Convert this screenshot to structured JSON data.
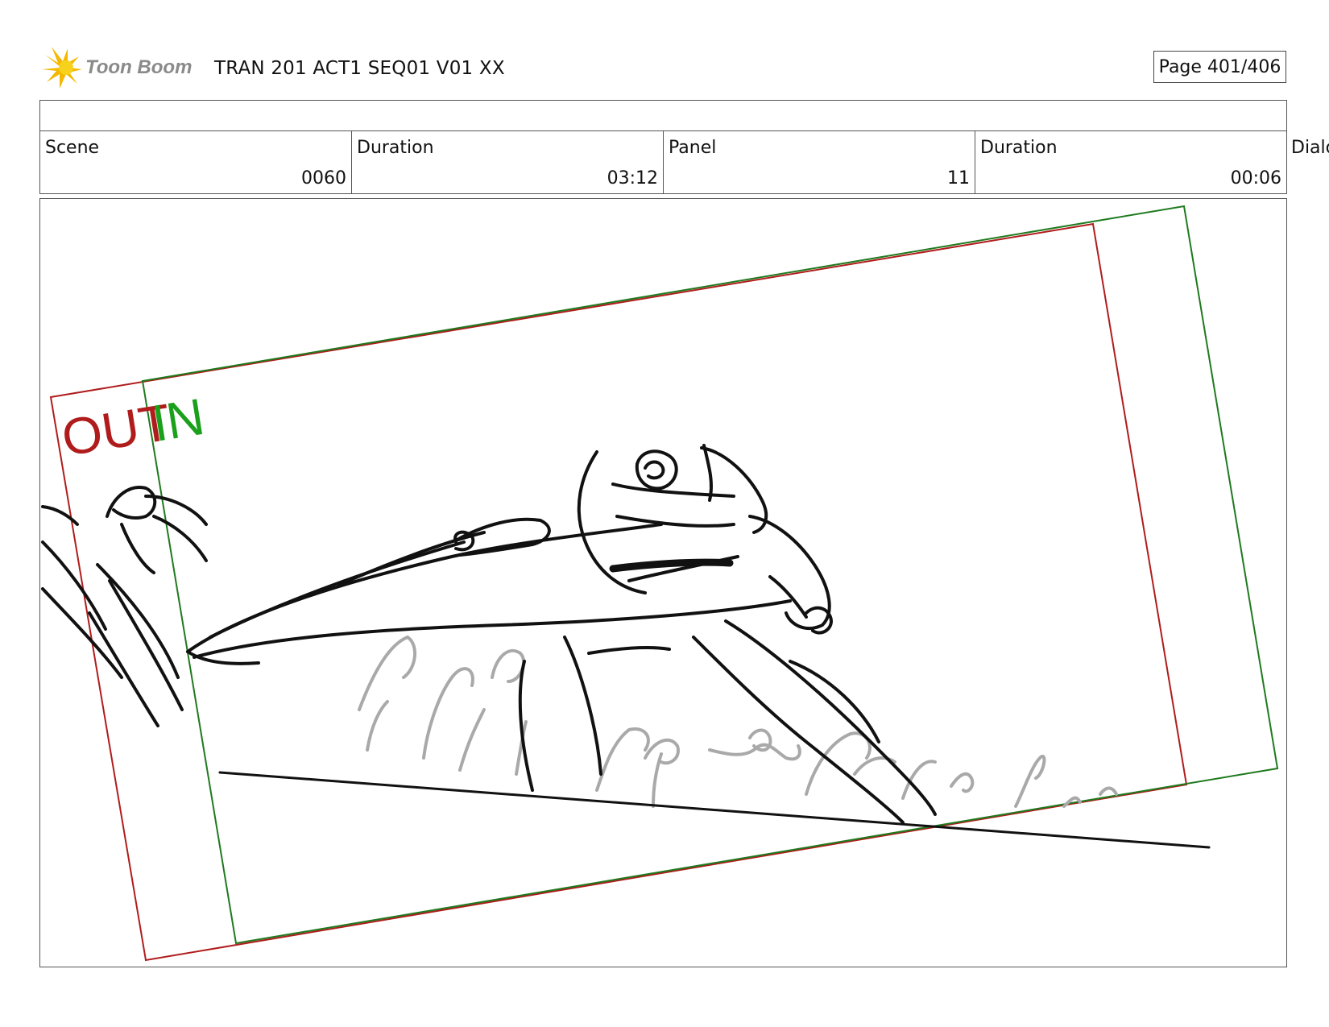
{
  "header": {
    "logo_text": "Toon Boom",
    "title": "TRAN 201 ACT1 SEQ01 V01 XX",
    "page": "Page 401/406"
  },
  "info": {
    "scene_label": "Scene",
    "scene_value": "0060",
    "scene_duration_label": "Duration",
    "scene_duration_value": "03:12",
    "panel_label": "Panel",
    "panel_value": "11",
    "panel_duration_label": "Duration",
    "panel_duration_value": "00:06",
    "dialog_label_partial": "Dialo"
  },
  "frame_labels": {
    "out": "OUT",
    "in": "IN",
    "out_color": "#b01c1c",
    "in_color": "#1aa01a"
  },
  "colors": {
    "out_frame": "#b01c1c",
    "in_frame": "#1e7a1e",
    "sketch_ink": "#111111",
    "background_sketch": "#a9a9a9"
  }
}
